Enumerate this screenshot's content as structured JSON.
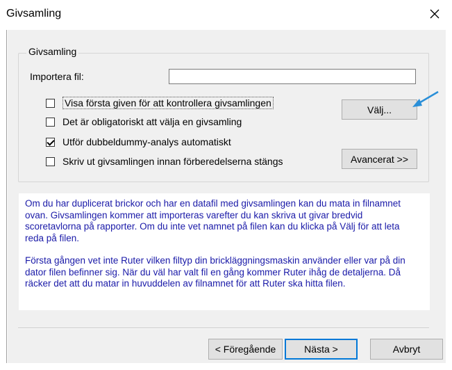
{
  "window": {
    "title": "Givsamling",
    "close_glyph": "✕"
  },
  "group": {
    "legend": "Givsamling",
    "import_label": "Importera fil:",
    "import_value": ""
  },
  "checkboxes": [
    {
      "label": "Visa första given för att kontrollera givsamlingen",
      "checked": false
    },
    {
      "label": "Det är obligatoriskt att välja en givsamling",
      "checked": false
    },
    {
      "label": "Utför dubbeldummy-analys automatiskt",
      "checked": true
    },
    {
      "label": "Skriv ut givsamlingen innan förberedelserna stängs",
      "checked": false
    }
  ],
  "buttons": {
    "choose": "Välj...",
    "advanced": "Avancerat >>",
    "previous": "< Föregående",
    "next": "Nästa >",
    "cancel": "Avbryt"
  },
  "info": {
    "para1": "Om du har duplicerat brickor och har en datafil med givsamlingen kan du mata in filnamnet ovan. Givsamlingen kommer att importeras varefter du kan skriva ut givar bredvid scoretavlorna på rapporter. Om du inte vet namnet på filen kan du klicka på Välj för att leta reda på filen.",
    "para2": "Första gången vet inte Ruter vilken filtyp din brickläggningsmaskin använder eller var på din dator filen befinner sig. När du väl har valt fil en gång kommer Ruter ihåg de detaljerna. Då räcker det att du matar in huvuddelen av filnamnet för att Ruter ska hitta filen."
  },
  "colors": {
    "info_text": "#1a1aa8",
    "arrow": "#2a8fd8"
  },
  "icons": {
    "close": "close-icon",
    "arrow": "pointer-arrow-icon"
  }
}
